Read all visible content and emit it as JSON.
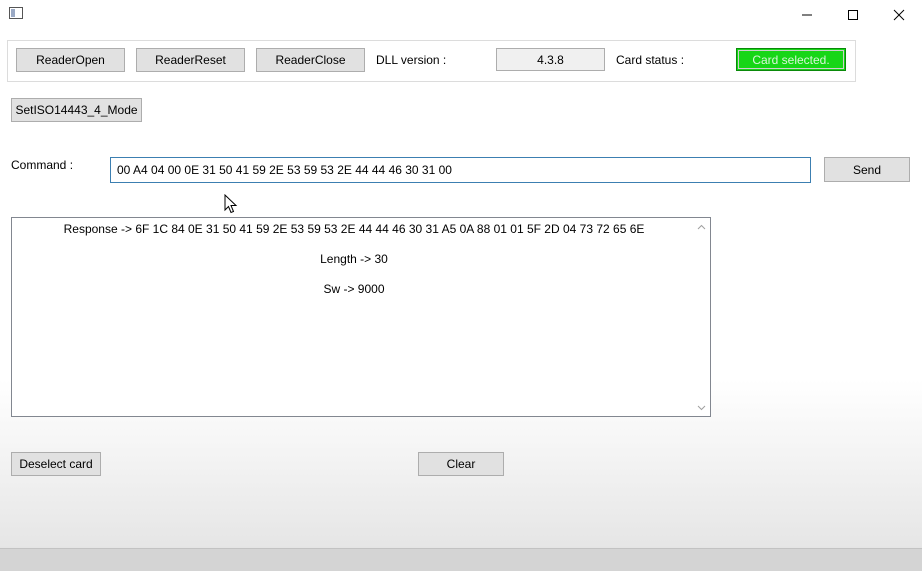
{
  "window": {
    "minimize_glyph": "–",
    "maximize_glyph": "☐",
    "close_glyph": "✕"
  },
  "toolbar": {
    "reader_open": "ReaderOpen",
    "reader_reset": "ReaderReset",
    "reader_close": "ReaderClose",
    "dll_label": "DLL version :",
    "dll_value": "4.3.8",
    "card_status_label": "Card status :",
    "card_status_value": "Card selected.",
    "card_status_color": "#17d617"
  },
  "mode_button": "SetISO14443_4_Mode",
  "command": {
    "label": "Command :",
    "value": "00 A4 04 00 0E 31 50 41 59 2E 53 59 53 2E 44 44 46 30 31 00",
    "send": "Send"
  },
  "response": {
    "lines": [
      "Response -> 6F 1C 84 0E 31 50 41 59 2E 53 59 53 2E 44 44 46 30 31 A5 0A 88 01 01 5F 2D 04 73 72 65 6E",
      "Length -> 30",
      "Sw -> 9000"
    ]
  },
  "footer": {
    "deselect": "Deselect card",
    "clear": "Clear"
  },
  "icons": {
    "app": "app-window-icon",
    "cursor": "mouse-pointer-icon",
    "scroll_up": "scroll-up-arrow-icon",
    "scroll_down": "scroll-down-arrow-icon"
  }
}
